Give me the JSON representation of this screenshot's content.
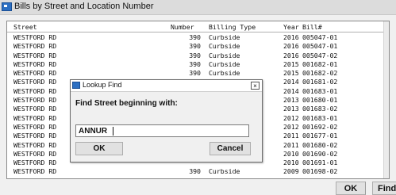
{
  "window": {
    "title": "Bills by Street and Location Number",
    "icon": "table-icon"
  },
  "columns": [
    "Street",
    "Number",
    "Billing Type",
    "Year",
    "Bill#"
  ],
  "rows": [
    {
      "street": "WESTFORD RD",
      "number": "390",
      "type": "Curbside",
      "year": "2016",
      "bill": "005047-01"
    },
    {
      "street": "WESTFORD RD",
      "number": "390",
      "type": "Curbside",
      "year": "2016",
      "bill": "005047-01"
    },
    {
      "street": "WESTFORD RD",
      "number": "390",
      "type": "Curbside",
      "year": "2016",
      "bill": "005047-02"
    },
    {
      "street": "WESTFORD RD",
      "number": "390",
      "type": "Curbside",
      "year": "2015",
      "bill": "001682-01"
    },
    {
      "street": "WESTFORD RD",
      "number": "390",
      "type": "Curbside",
      "year": "2015",
      "bill": "001682-02"
    },
    {
      "street": "WESTFORD RD",
      "number": "",
      "type": "",
      "year": "2014",
      "bill": "001681-02"
    },
    {
      "street": "WESTFORD RD",
      "number": "",
      "type": "",
      "year": "2014",
      "bill": "001683-01"
    },
    {
      "street": "WESTFORD RD",
      "number": "",
      "type": "",
      "year": "2013",
      "bill": "001680-01"
    },
    {
      "street": "WESTFORD RD",
      "number": "",
      "type": "",
      "year": "2013",
      "bill": "001683-02"
    },
    {
      "street": "WESTFORD RD",
      "number": "",
      "type": "",
      "year": "2012",
      "bill": "001683-01"
    },
    {
      "street": "WESTFORD RD",
      "number": "",
      "type": "",
      "year": "2012",
      "bill": "001692-02"
    },
    {
      "street": "WESTFORD RD",
      "number": "",
      "type": "",
      "year": "2011",
      "bill": "001677-01"
    },
    {
      "street": "WESTFORD RD",
      "number": "",
      "type": "",
      "year": "2011",
      "bill": "001680-02"
    },
    {
      "street": "WESTFORD RD",
      "number": "",
      "type": "",
      "year": "2010",
      "bill": "001690-02"
    },
    {
      "street": "WESTFORD RD",
      "number": "",
      "type": "",
      "year": "2010",
      "bill": "001691-01"
    },
    {
      "street": "WESTFORD RD",
      "number": "390",
      "type": "Curbside",
      "year": "2009",
      "bill": "001698-02"
    }
  ],
  "buttons": {
    "ok": "OK",
    "find": "Find"
  },
  "dialog": {
    "title": "Lookup Find",
    "close": "×",
    "prompt": "Find Street beginning with:",
    "input_value": "ANNUR",
    "ok": "OK",
    "cancel": "Cancel"
  }
}
